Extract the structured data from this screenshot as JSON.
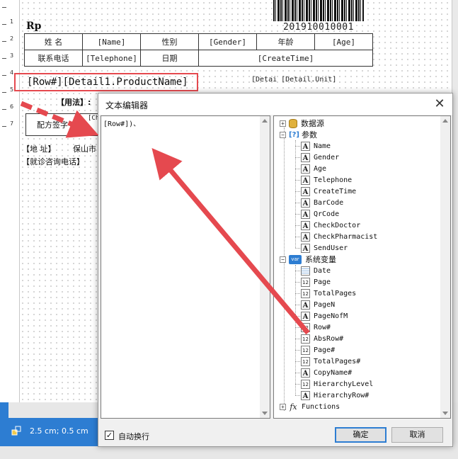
{
  "designer": {
    "ruler_numbers": [
      "1",
      "2",
      "3",
      "4",
      "5",
      "6",
      "7"
    ],
    "barcode_number": "201910010001",
    "rp_label": "Rp",
    "info_table": {
      "row1": [
        "姓  名",
        "[Name]",
        "性别",
        "[Gender]",
        "年龄",
        "[Age]"
      ],
      "row2": [
        "联系电话",
        "[Telephone]",
        "日期",
        "[CreateTime]"
      ]
    },
    "detail_row_text": "[Row#][Detail1.ProductName]",
    "detail_unit_text": "[Detai [Detail.Unit]",
    "usage_label": "【用法】:",
    "pharmacist_label": "配方签字",
    "ch_tag": "[Ch",
    "address_label": "【地    址】",
    "city_label": "保山市",
    "phone_label": "【就诊咨询电话】"
  },
  "status": {
    "position_text": "2.5 cm; 0.5 cm"
  },
  "dialog": {
    "title": "文本编辑器",
    "close_glyph": "✕",
    "editor_text": "[Row#])、",
    "tree": {
      "datasource": "数据源",
      "parameters": "参数",
      "parameter_items": [
        "Name",
        "Gender",
        "Age",
        "Telephone",
        "CreateTime",
        "BarCode",
        "QrCode",
        "CheckDoctor",
        "CheckPharmacist",
        "SendUser"
      ],
      "sysvars": "系统变量",
      "sysvar_items": [
        {
          "label": "Date",
          "icon": "date-icon"
        },
        {
          "label": "Page",
          "icon": "number-icon"
        },
        {
          "label": "TotalPages",
          "icon": "number-icon"
        },
        {
          "label": "PageN",
          "icon": "text-icon"
        },
        {
          "label": "PageNofM",
          "icon": "text-icon"
        },
        {
          "label": "Row#",
          "icon": "number-icon"
        },
        {
          "label": "AbsRow#",
          "icon": "number-icon"
        },
        {
          "label": "Page#",
          "icon": "number-icon"
        },
        {
          "label": "TotalPages#",
          "icon": "number-icon"
        },
        {
          "label": "CopyName#",
          "icon": "text-icon"
        },
        {
          "label": "HierarchyLevel",
          "icon": "number-icon"
        },
        {
          "label": "HierarchyRow#",
          "icon": "text-icon"
        }
      ],
      "functions": "Functions"
    },
    "word_wrap_label": "自动换行",
    "word_wrap_checked": "✓",
    "ok_label": "确定",
    "cancel_label": "取消"
  },
  "colors": {
    "annotation": "#e5494f",
    "accent": "#2d7dd2"
  }
}
